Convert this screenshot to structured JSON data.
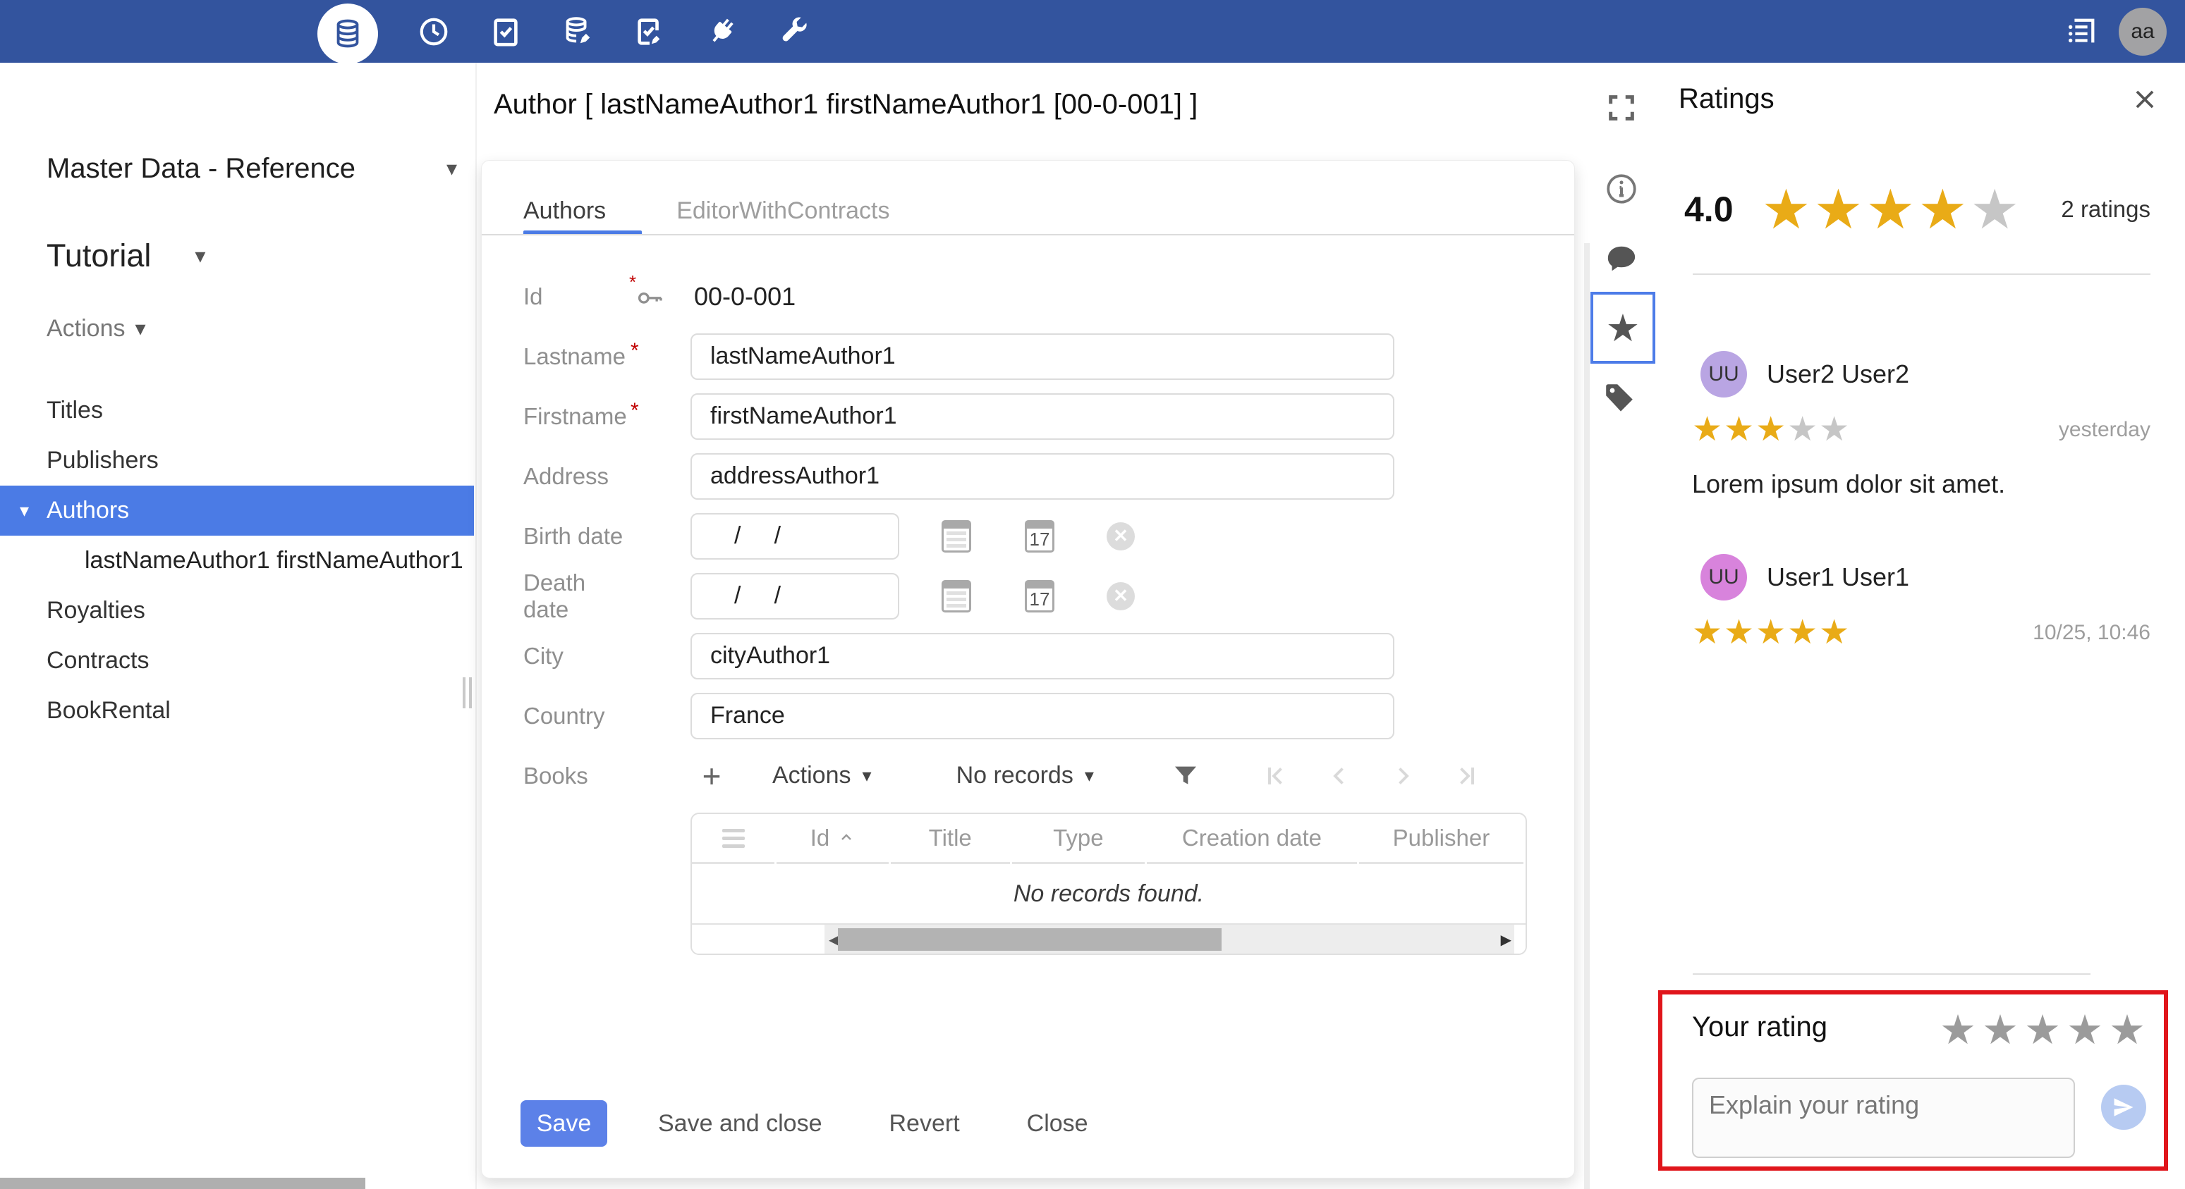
{
  "colors": {
    "topbar": "#33549E",
    "accent": "#4B7BE5",
    "save_button": "#5C81E8",
    "star_gold": "#E9AB17",
    "star_gray": "#C6C6C6",
    "star_muted": "#9B9B9B",
    "highlight_red": "#E0151B",
    "send_bg": "#B7CBF2",
    "avatar_user2": "#B9A5E3",
    "avatar_user1": "#D883DC",
    "topbar_avatar": "#A2A2A4"
  },
  "icons": {
    "star": "★",
    "caret_down": "▾",
    "scroll_left": "◀",
    "scroll_right": "▶",
    "clear": "✕",
    "calendar_day": "17",
    "topbar_names": [
      "database",
      "clock",
      "task-check",
      "database-edit",
      "task-edit",
      "plug",
      "wrench"
    ],
    "right_strip_names": [
      "expand",
      "info",
      "comment",
      "star",
      "tag"
    ]
  },
  "topbar": {
    "avatar_initials": "aa"
  },
  "sidebar": {
    "module_title": "Master Data - Reference",
    "submodule": "Tutorial",
    "actions_label": "Actions",
    "items": [
      {
        "label": "Titles",
        "selected": false
      },
      {
        "label": "Publishers",
        "selected": false
      },
      {
        "label": "Authors",
        "selected": true,
        "expanded": true
      },
      {
        "label": "lastNameAuthor1 firstNameAuthor1",
        "child": true
      },
      {
        "label": "Royalties",
        "selected": false
      },
      {
        "label": "Contracts",
        "selected": false
      },
      {
        "label": "BookRental",
        "selected": false
      }
    ]
  },
  "main": {
    "title": "Author [ lastNameAuthor1 firstNameAuthor1 [00-0-001] ]",
    "tabs": [
      {
        "label": "Authors",
        "active": true
      },
      {
        "label": "EditorWithContracts",
        "active": false
      }
    ],
    "required_marker": "*",
    "form": {
      "id": {
        "label": "Id",
        "value": "00-0-001"
      },
      "lastname": {
        "label": "Lastname",
        "required": true,
        "value": "lastNameAuthor1"
      },
      "firstname": {
        "label": "Firstname",
        "required": true,
        "value": "firstNameAuthor1"
      },
      "address": {
        "label": "Address",
        "value": "addressAuthor1"
      },
      "birth_date": {
        "label": "Birth date",
        "value": "/     /"
      },
      "death_date": {
        "label": "Death date",
        "value": "/     /"
      },
      "city": {
        "label": "City",
        "value": "cityAuthor1"
      },
      "country": {
        "label": "Country",
        "value": "France"
      }
    },
    "books": {
      "label": "Books",
      "add_label": "+",
      "actions_label": "Actions",
      "records_label": "No records",
      "columns": [
        "Id",
        "Title",
        "Type",
        "Creation date",
        "Publisher"
      ],
      "empty_message": "No records found."
    },
    "buttons": {
      "save": "Save",
      "save_and_close": "Save and close",
      "revert": "Revert",
      "close": "Close"
    }
  },
  "ratings": {
    "title": "Ratings",
    "average": "4.0",
    "average_stars": 4,
    "count_label": "2 ratings",
    "reviews": [
      {
        "initials": "UU",
        "name": "User2 User2",
        "stars": 3,
        "time": "yesterday",
        "comment": "Lorem ipsum dolor sit amet.",
        "avatar_color": "#B9A5E3"
      },
      {
        "initials": "UU",
        "name": "User1 User1",
        "stars": 5,
        "time": "10/25, 10:46",
        "comment": "",
        "avatar_color": "#D883DC"
      }
    ],
    "your_rating": {
      "label": "Your rating",
      "stars": 0,
      "placeholder": "Explain your rating"
    }
  }
}
